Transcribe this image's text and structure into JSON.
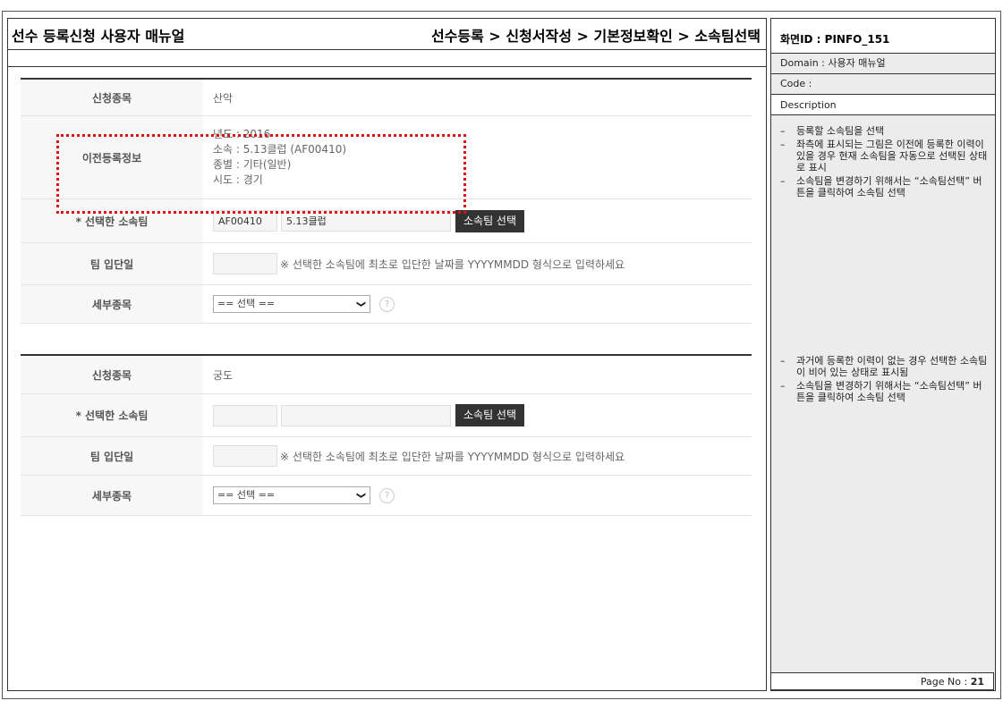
{
  "header": {
    "title": "선수 등록신청 사용자 매뉴얼",
    "breadcrumb": "선수등록 > 신청서작성 > 기본정보확인 > 소속팀선택"
  },
  "form1": {
    "rows": {
      "sport_label": "신청종목",
      "sport_value": "산악",
      "prev_label": "이전등록정보",
      "prev_year": "년도 : 2016",
      "prev_team": "소속 : 5.13클럽 (AF00410)",
      "prev_type": "종별 : 기타(일반)",
      "prev_region": "시도 : 경기",
      "team_label": "* 선택한 소속팀",
      "team_code": "AF00410",
      "team_name": "5.13클럽",
      "team_button": "소속팀 선택",
      "join_label": "팀 입단일",
      "join_hint": "※ 선택한 소속팀에 최초로 입단한 날짜를 YYYYMMDD 형식으로 입력하세요",
      "detail_label": "세부종목",
      "detail_select": "== 선택 ==",
      "help_icon": "?"
    }
  },
  "form2": {
    "rows": {
      "sport_label": "신청종목",
      "sport_value": "궁도",
      "team_label": "* 선택한 소속팀",
      "team_button": "소속팀 선택",
      "join_label": "팀 입단일",
      "join_hint": "※ 선택한 소속팀에 최초로 입단한 날짜를 YYYYMMDD 형식으로 입력하세요",
      "detail_label": "세부종목",
      "detail_select": "== 선택 ==",
      "help_icon": "?"
    }
  },
  "side": {
    "screen_id": "화면ID : PINFO_151",
    "domain": "Domain : 사용자 매뉴얼",
    "code": "Code :",
    "description": "Description",
    "notes1": [
      "등록할 소속팀을 선택",
      "좌측에 표시되는 그림은 이전에 등록한 이력이 있을 경우 현재 소속팀을 자동으로 선택된 상태로 표시",
      "소속팀을 변경하기 위해서는 “소속팀선택” 버튼을 클릭하여 소속팀 선택"
    ],
    "notes2": [
      "과거에 등록한 이력이 없는 경우 선택한 소속팀이 비어 있는 상태로 표시됨",
      "소속팀을 변경하기 위해서는 “소속팀선택” 버튼을 클릭하여 소속팀 선택"
    ],
    "page_label": "Page No :",
    "page_no": "21"
  },
  "colors": {
    "highlight": "#dd1111",
    "button_bg": "#333333",
    "label_bg": "#f7f7f7"
  }
}
